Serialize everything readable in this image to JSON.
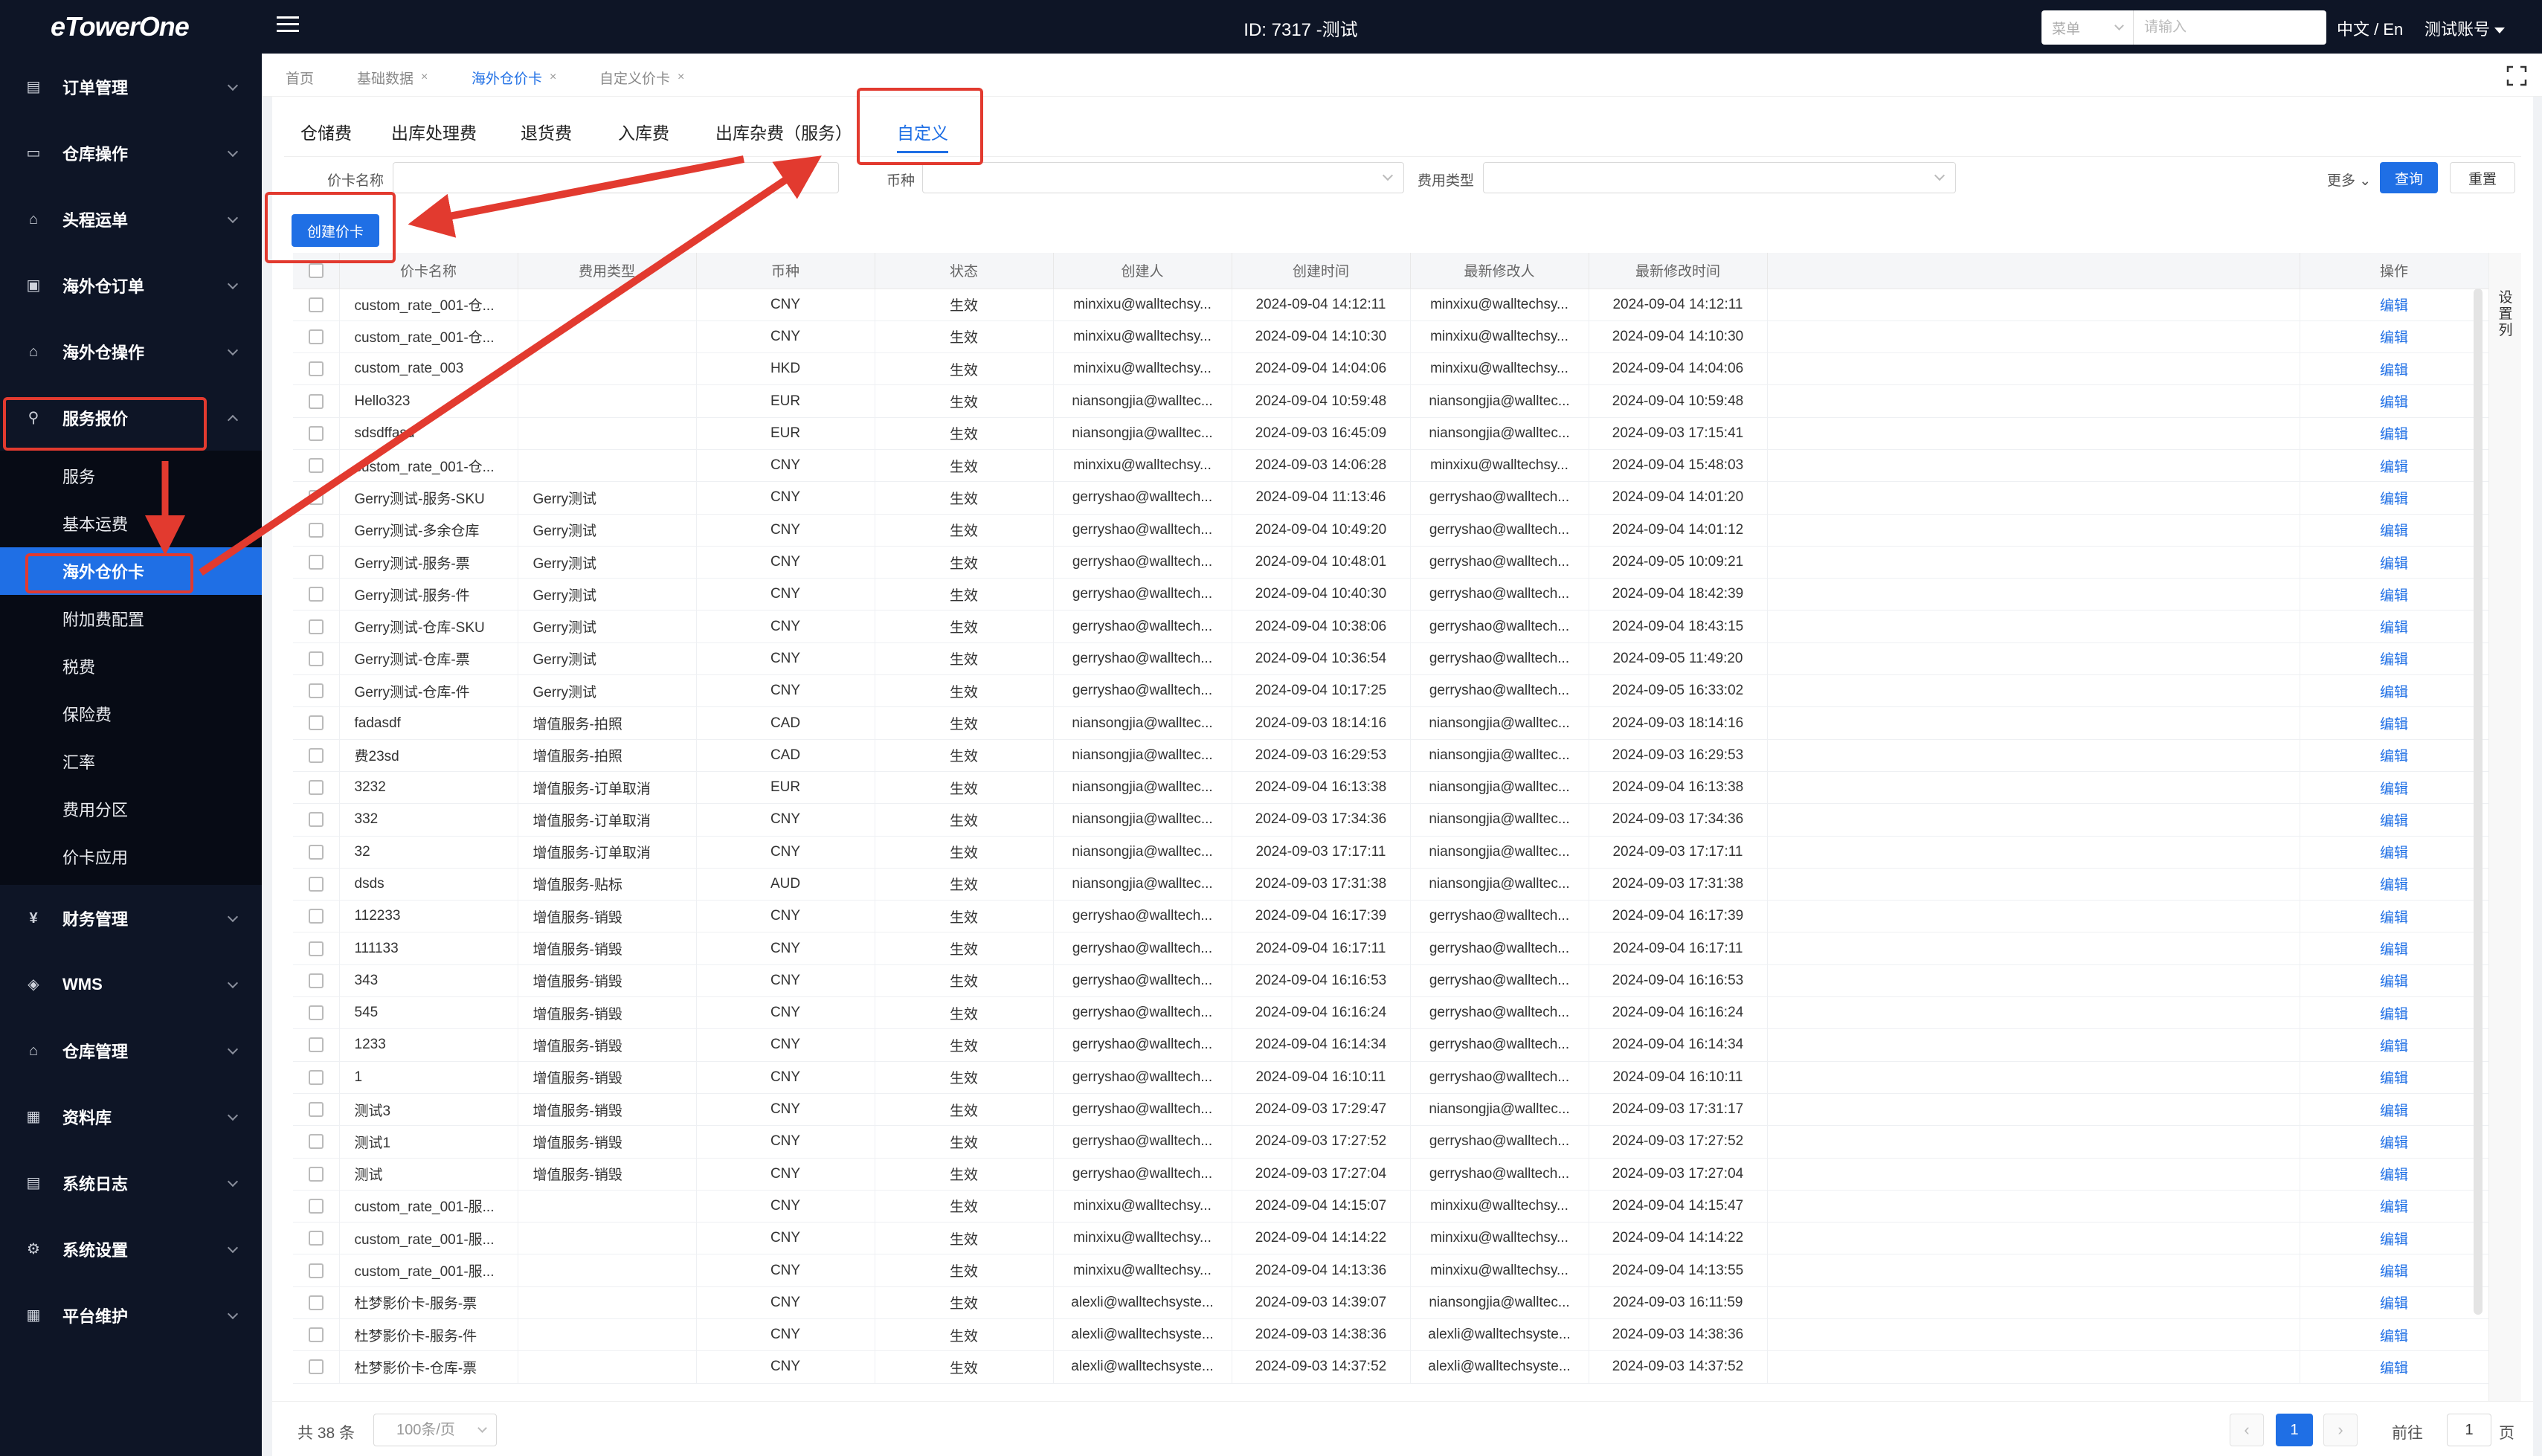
{
  "app": {
    "logo": "eTowerOne",
    "window_id": "ID: 7317 -测试",
    "language": "中文 / En",
    "account": "测试账号"
  },
  "top_search": {
    "select_label": "菜单",
    "placeholder": "请输入"
  },
  "sidebar": {
    "groups": [
      {
        "label": "订单管理",
        "icon": "order-icon"
      },
      {
        "label": "仓库操作",
        "icon": "warehouse-op-icon"
      },
      {
        "label": "头程运单",
        "icon": "first-leg-icon"
      },
      {
        "label": "海外仓订单",
        "icon": "overseas-order-icon"
      },
      {
        "label": "海外仓操作",
        "icon": "overseas-op-icon"
      },
      {
        "label": "服务报价",
        "icon": "quote-icon"
      }
    ],
    "submenu": [
      "服务",
      "基本运费",
      "海外仓价卡",
      "附加费配置",
      "税费",
      "保险费",
      "汇率",
      "费用分区",
      "价卡应用"
    ],
    "groups_after": [
      {
        "label": "财务管理",
        "icon": "finance-icon"
      },
      {
        "label": "WMS",
        "icon": "wms-icon"
      },
      {
        "label": "仓库管理",
        "icon": "warehouse-mgmt-icon"
      },
      {
        "label": "资料库",
        "icon": "library-icon"
      },
      {
        "label": "系统日志",
        "icon": "log-icon"
      },
      {
        "label": "系统设置",
        "icon": "settings-icon"
      },
      {
        "label": "平台维护",
        "icon": "platform-icon"
      }
    ]
  },
  "page_tabs": [
    "首页",
    "基础数据",
    "海外仓价卡",
    "自定义价卡"
  ],
  "type_tabs": [
    "仓储费",
    "出库处理费",
    "退货费",
    "入库费",
    "出库杂费（服务）",
    "自定义"
  ],
  "filters": {
    "name_label": "价卡名称",
    "currency_label": "币种",
    "fee_type_label": "费用类型",
    "more": "更多",
    "query": "查询",
    "reset": "重置"
  },
  "create_button": "创建价卡",
  "table": {
    "columns": [
      "价卡名称",
      "费用类型",
      "币种",
      "状态",
      "创建人",
      "创建时间",
      "最新修改人",
      "最新修改时间",
      "操作"
    ],
    "settings_label": "设置列",
    "edit_label": "编辑",
    "rows": [
      [
        "custom_rate_001-仓...",
        "",
        "CNY",
        "生效",
        "minxixu@walltechsy...",
        "2024-09-04 14:12:11",
        "minxixu@walltechsy...",
        "2024-09-04 14:12:11"
      ],
      [
        "custom_rate_001-仓...",
        "",
        "CNY",
        "生效",
        "minxixu@walltechsy...",
        "2024-09-04 14:10:30",
        "minxixu@walltechsy...",
        "2024-09-04 14:10:30"
      ],
      [
        "custom_rate_003",
        "",
        "HKD",
        "生效",
        "minxixu@walltechsy...",
        "2024-09-04 14:04:06",
        "minxixu@walltechsy...",
        "2024-09-04 14:04:06"
      ],
      [
        "Hello323",
        "",
        "EUR",
        "生效",
        "niansongjia@walltec...",
        "2024-09-04 10:59:48",
        "niansongjia@walltec...",
        "2024-09-04 10:59:48"
      ],
      [
        "sdsdffasd",
        "",
        "EUR",
        "生效",
        "niansongjia@walltec...",
        "2024-09-03 16:45:09",
        "niansongjia@walltec...",
        "2024-09-03 17:15:41"
      ],
      [
        "custom_rate_001-仓...",
        "",
        "CNY",
        "生效",
        "minxixu@walltechsy...",
        "2024-09-03 14:06:28",
        "minxixu@walltechsy...",
        "2024-09-04 15:48:03"
      ],
      [
        "Gerry测试-服务-SKU",
        "Gerry测试",
        "CNY",
        "生效",
        "gerryshao@walltech...",
        "2024-09-04 11:13:46",
        "gerryshao@walltech...",
        "2024-09-04 14:01:20"
      ],
      [
        "Gerry测试-多余仓库",
        "Gerry测试",
        "CNY",
        "生效",
        "gerryshao@walltech...",
        "2024-09-04 10:49:20",
        "gerryshao@walltech...",
        "2024-09-04 14:01:12"
      ],
      [
        "Gerry测试-服务-票",
        "Gerry测试",
        "CNY",
        "生效",
        "gerryshao@walltech...",
        "2024-09-04 10:48:01",
        "gerryshao@walltech...",
        "2024-09-05 10:09:21"
      ],
      [
        "Gerry测试-服务-件",
        "Gerry测试",
        "CNY",
        "生效",
        "gerryshao@walltech...",
        "2024-09-04 10:40:30",
        "gerryshao@walltech...",
        "2024-09-04 18:42:39"
      ],
      [
        "Gerry测试-仓库-SKU",
        "Gerry测试",
        "CNY",
        "生效",
        "gerryshao@walltech...",
        "2024-09-04 10:38:06",
        "gerryshao@walltech...",
        "2024-09-04 18:43:15"
      ],
      [
        "Gerry测试-仓库-票",
        "Gerry测试",
        "CNY",
        "生效",
        "gerryshao@walltech...",
        "2024-09-04 10:36:54",
        "gerryshao@walltech...",
        "2024-09-05 11:49:20"
      ],
      [
        "Gerry测试-仓库-件",
        "Gerry测试",
        "CNY",
        "生效",
        "gerryshao@walltech...",
        "2024-09-04 10:17:25",
        "gerryshao@walltech...",
        "2024-09-05 16:33:02"
      ],
      [
        "fadasdf",
        "增值服务-拍照",
        "CAD",
        "生效",
        "niansongjia@walltec...",
        "2024-09-03 18:14:16",
        "niansongjia@walltec...",
        "2024-09-03 18:14:16"
      ],
      [
        "费23sd",
        "增值服务-拍照",
        "CAD",
        "生效",
        "niansongjia@walltec...",
        "2024-09-03 16:29:53",
        "niansongjia@walltec...",
        "2024-09-03 16:29:53"
      ],
      [
        "3232",
        "增值服务-订单取消",
        "EUR",
        "生效",
        "niansongjia@walltec...",
        "2024-09-04 16:13:38",
        "niansongjia@walltec...",
        "2024-09-04 16:13:38"
      ],
      [
        "332",
        "增值服务-订单取消",
        "CNY",
        "生效",
        "niansongjia@walltec...",
        "2024-09-03 17:34:36",
        "niansongjia@walltec...",
        "2024-09-03 17:34:36"
      ],
      [
        "32",
        "增值服务-订单取消",
        "CNY",
        "生效",
        "niansongjia@walltec...",
        "2024-09-03 17:17:11",
        "niansongjia@walltec...",
        "2024-09-03 17:17:11"
      ],
      [
        "dsds",
        "增值服务-贴标",
        "AUD",
        "生效",
        "niansongjia@walltec...",
        "2024-09-03 17:31:38",
        "niansongjia@walltec...",
        "2024-09-03 17:31:38"
      ],
      [
        "112233",
        "增值服务-销毁",
        "CNY",
        "生效",
        "gerryshao@walltech...",
        "2024-09-04 16:17:39",
        "gerryshao@walltech...",
        "2024-09-04 16:17:39"
      ],
      [
        "111133",
        "增值服务-销毁",
        "CNY",
        "生效",
        "gerryshao@walltech...",
        "2024-09-04 16:17:11",
        "gerryshao@walltech...",
        "2024-09-04 16:17:11"
      ],
      [
        "343",
        "增值服务-销毁",
        "CNY",
        "生效",
        "gerryshao@walltech...",
        "2024-09-04 16:16:53",
        "gerryshao@walltech...",
        "2024-09-04 16:16:53"
      ],
      [
        "545",
        "增值服务-销毁",
        "CNY",
        "生效",
        "gerryshao@walltech...",
        "2024-09-04 16:16:24",
        "gerryshao@walltech...",
        "2024-09-04 16:16:24"
      ],
      [
        "1233",
        "增值服务-销毁",
        "CNY",
        "生效",
        "gerryshao@walltech...",
        "2024-09-04 16:14:34",
        "gerryshao@walltech...",
        "2024-09-04 16:14:34"
      ],
      [
        "1",
        "增值服务-销毁",
        "CNY",
        "生效",
        "gerryshao@walltech...",
        "2024-09-04 16:10:11",
        "gerryshao@walltech...",
        "2024-09-04 16:10:11"
      ],
      [
        "测试3",
        "增值服务-销毁",
        "CNY",
        "生效",
        "gerryshao@walltech...",
        "2024-09-03 17:29:47",
        "niansongjia@walltec...",
        "2024-09-03 17:31:17"
      ],
      [
        "测试1",
        "增值服务-销毁",
        "CNY",
        "生效",
        "gerryshao@walltech...",
        "2024-09-03 17:27:52",
        "gerryshao@walltech...",
        "2024-09-03 17:27:52"
      ],
      [
        "测试",
        "增值服务-销毁",
        "CNY",
        "生效",
        "gerryshao@walltech...",
        "2024-09-03 17:27:04",
        "gerryshao@walltech...",
        "2024-09-03 17:27:04"
      ],
      [
        "custom_rate_001-服...",
        "",
        "CNY",
        "生效",
        "minxixu@walltechsy...",
        "2024-09-04 14:15:07",
        "minxixu@walltechsy...",
        "2024-09-04 14:15:47"
      ],
      [
        "custom_rate_001-服...",
        "",
        "CNY",
        "生效",
        "minxixu@walltechsy...",
        "2024-09-04 14:14:22",
        "minxixu@walltechsy...",
        "2024-09-04 14:14:22"
      ],
      [
        "custom_rate_001-服...",
        "",
        "CNY",
        "生效",
        "minxixu@walltechsy...",
        "2024-09-04 14:13:36",
        "minxixu@walltechsy...",
        "2024-09-04 14:13:55"
      ],
      [
        "杜梦影价卡-服务-票",
        "",
        "CNY",
        "生效",
        "alexli@walltechsyste...",
        "2024-09-03 14:39:07",
        "niansongjia@walltec...",
        "2024-09-03 16:11:59"
      ],
      [
        "杜梦影价卡-服务-件",
        "",
        "CNY",
        "生效",
        "alexli@walltechsyste...",
        "2024-09-03 14:38:36",
        "alexli@walltechsyste...",
        "2024-09-03 14:38:36"
      ],
      [
        "杜梦影价卡-仓库-票",
        "",
        "CNY",
        "生效",
        "alexli@walltechsyste...",
        "2024-09-03 14:37:52",
        "alexli@walltechsyste...",
        "2024-09-03 14:37:52"
      ]
    ]
  },
  "pagination": {
    "total": "共 38 条",
    "page_size": "100条/页",
    "current": "1",
    "goto_label": "前往",
    "goto_value": "1",
    "goto_unit": "页",
    "prev": "‹",
    "next": "›"
  },
  "colors": {
    "accent": "#1f6fe5",
    "sidebar_bg": "#0e1526",
    "annotation": "#e23a2f"
  }
}
